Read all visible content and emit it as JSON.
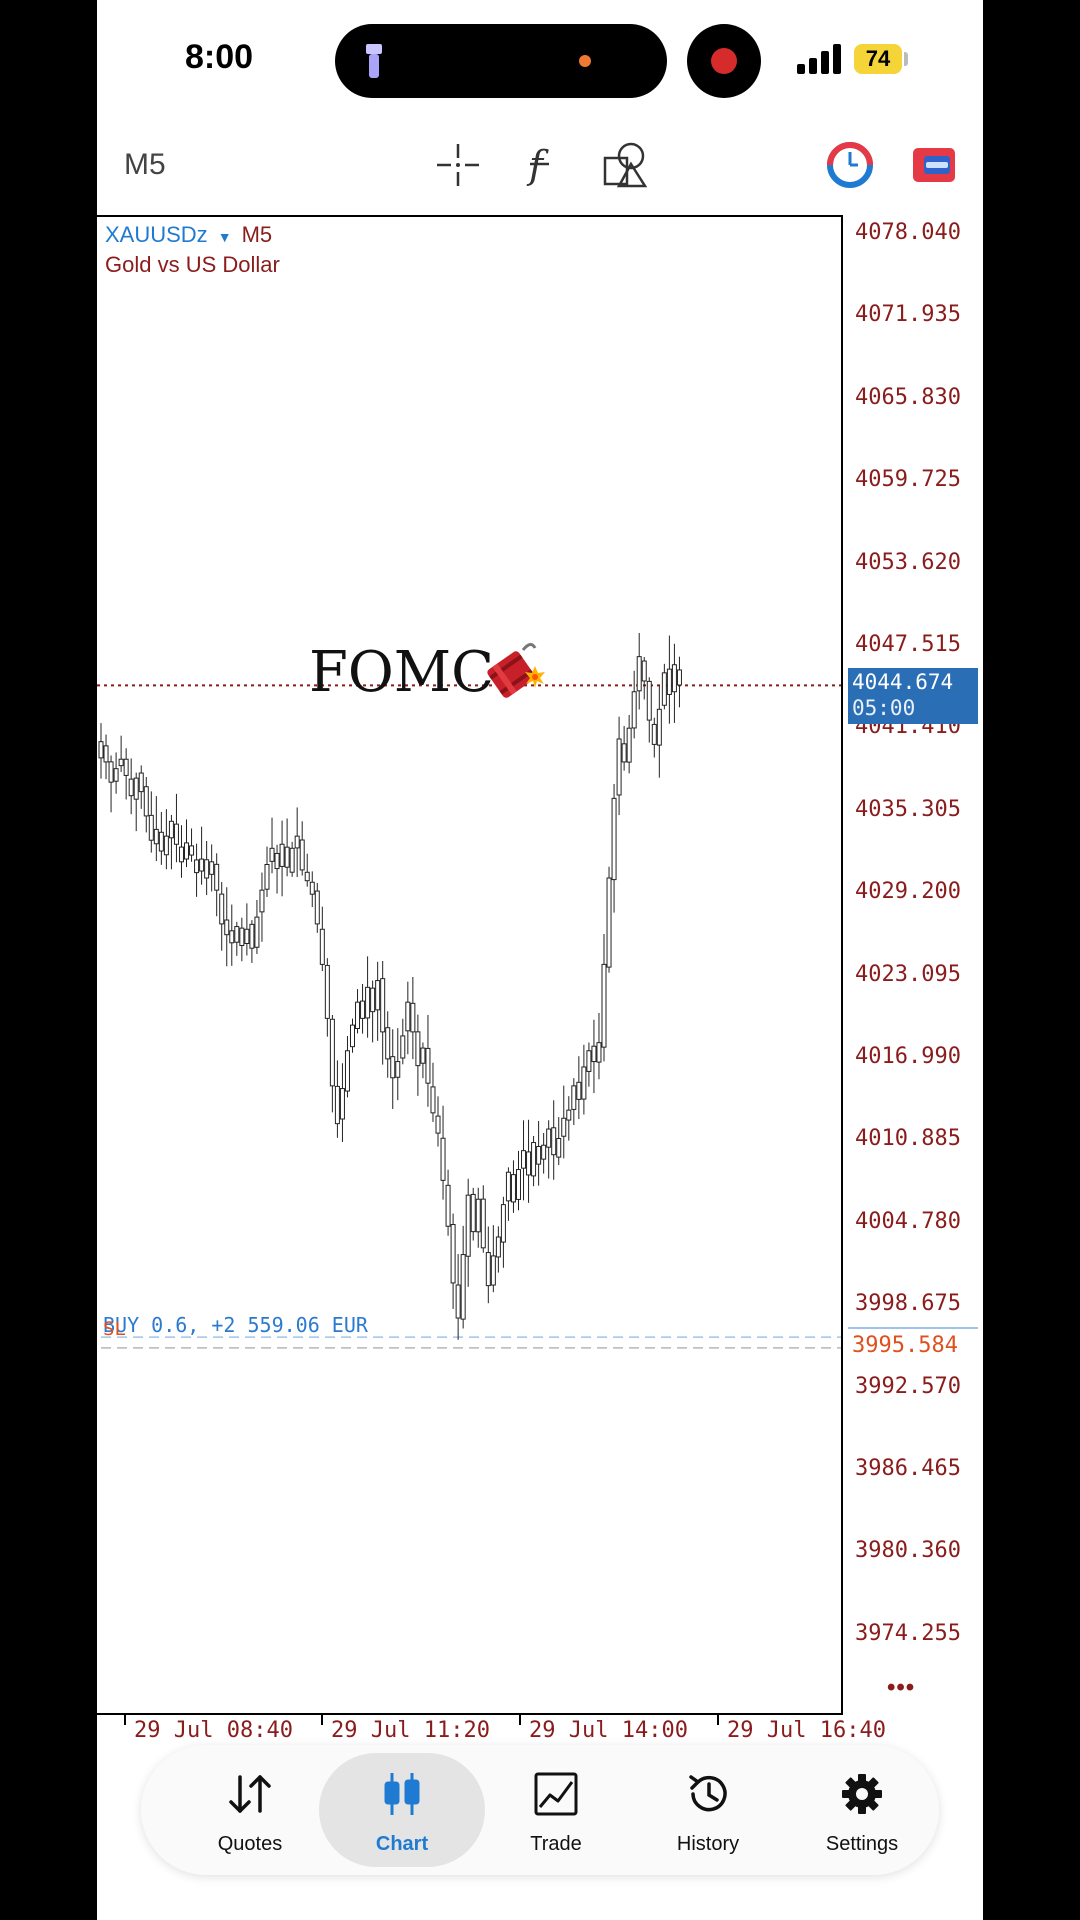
{
  "status": {
    "time": "8:00",
    "battery": "74"
  },
  "toolbar": {
    "timeframe": "M5",
    "icons": [
      "crosshair-icon",
      "function-icon",
      "shapes-icon",
      "one-click-trading-icon",
      "account-icon"
    ]
  },
  "chart": {
    "symbol": "XAUUSDz",
    "timeframe": "M5",
    "description": "Gold vs US Dollar",
    "annotation_text": "FOMC",
    "current_price": "4044.674",
    "countdown": "05:00",
    "position_label": "BUY 0.6, +2 559.06 EUR",
    "sl_label": "SL",
    "sl_price": "3995.584",
    "more": "•••",
    "price_axis": [
      "4078.040",
      "4071.935",
      "4065.830",
      "4059.725",
      "4053.620",
      "4047.515",
      "4041.410",
      "4035.305",
      "4029.200",
      "4023.095",
      "4016.990",
      "4010.885",
      "4004.780",
      "3998.675",
      "3992.570",
      "3986.465",
      "3980.360",
      "3974.255"
    ],
    "time_axis": [
      "29 Jul 08:40",
      "29 Jul 11:20",
      "29 Jul 14:00",
      "29 Jul 16:40"
    ],
    "colors": {
      "axis_text": "#8a1c1c",
      "symbol": "#1f7bd1",
      "price_box": "#2a6eb5",
      "sl": "#e0501f"
    }
  },
  "chart_data": {
    "type": "candlestick",
    "symbol": "XAUUSDz",
    "timeframe": "M5",
    "ylim": [
      3970.0,
      4082.0
    ],
    "current_price": 4044.674,
    "sl_price": 3995.584,
    "close_path": [
      4040.5,
      4039.0,
      4037.5,
      4038.5,
      4039.2,
      4038.0,
      4036.5,
      4037.8,
      4036.8,
      4035.0,
      4033.2,
      4034.0,
      4032.4,
      4033.5,
      4034.6,
      4032.9,
      4031.6,
      4033.0,
      4032.1,
      4030.8,
      4031.8,
      4030.4,
      4031.6,
      4029.5,
      4027.0,
      4026.2,
      4025.6,
      4026.8,
      4025.4,
      4026.6,
      4025.2,
      4027.5,
      4029.5,
      4031.4,
      4032.6,
      4031.1,
      4032.9,
      4031.2,
      4032.6,
      4033.5,
      4031.0,
      4030.2,
      4029.2,
      4027.0,
      4024.0,
      4020.0,
      4015.0,
      4012.2,
      4014.8,
      4017.6,
      4019.5,
      4021.2,
      4020.0,
      4022.3,
      4020.5,
      4022.8,
      4019.0,
      4017.0,
      4015.6,
      4016.8,
      4018.7,
      4021.2,
      4019.0,
      4016.5,
      4017.8,
      4015.2,
      4013.0,
      4011.5,
      4008.0,
      4004.6,
      4000.4,
      3997.8,
      4002.5,
      4006.9,
      4004.2,
      4006.6,
      4003.0,
      4000.2,
      4002.4,
      4003.8,
      4006.2,
      4008.6,
      4006.4,
      4008.8,
      4010.2,
      4008.4,
      4010.8,
      4009.2,
      4010.6,
      4011.8,
      4009.9,
      4011.1,
      4012.6,
      4013.2,
      4015.0,
      4014.0,
      4016.4,
      4017.6,
      4016.8,
      4018.2,
      4024.0,
      4030.4,
      4036.3,
      4040.7,
      4039.0,
      4041.5,
      4044.2,
      4046.8,
      4045.0,
      4042.1,
      4040.3,
      4042.9,
      4045.6,
      4044.0,
      4046.2,
      4044.7
    ]
  }
}
